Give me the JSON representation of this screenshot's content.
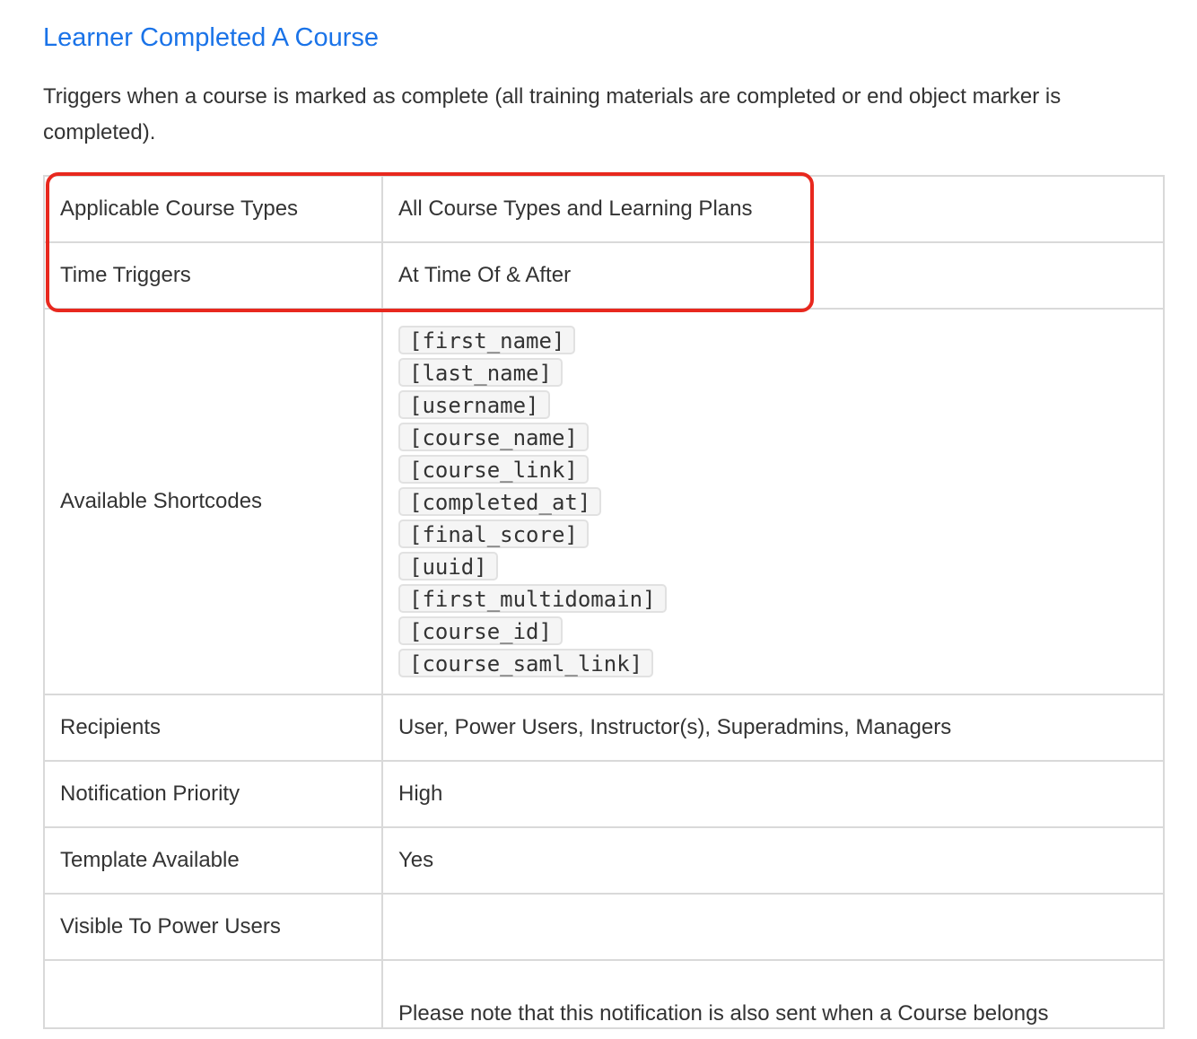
{
  "section": {
    "title": "Learner Completed A Course",
    "description": "Triggers when a course is marked as complete (all training materials are completed or end object marker is completed)."
  },
  "table": {
    "rows": [
      {
        "label": "Applicable Course Types",
        "value": "All Course Types and Learning Plans"
      },
      {
        "label": "Time Triggers",
        "value": "At Time Of & After"
      },
      {
        "label": "Available Shortcodes",
        "codes": [
          "[first_name]",
          "[last_name]",
          "[username]",
          "[course_name]",
          "[course_link]",
          "[completed_at]",
          "[final_score]",
          "[uuid]",
          "[first_multidomain]",
          "[course_id]",
          "[course_saml_link]"
        ]
      },
      {
        "label": "Recipients",
        "value": "User, Power Users, Instructor(s), Superadmins, Managers"
      },
      {
        "label": "Notification Priority",
        "value": "High"
      },
      {
        "label": "Template Available",
        "value": "Yes"
      },
      {
        "label": "Visible To Power Users",
        "value": ""
      },
      {
        "label": "",
        "value": "Please note that this notification is also sent when a Course belongs"
      }
    ]
  },
  "annotation": {
    "color": "#e8281e"
  }
}
